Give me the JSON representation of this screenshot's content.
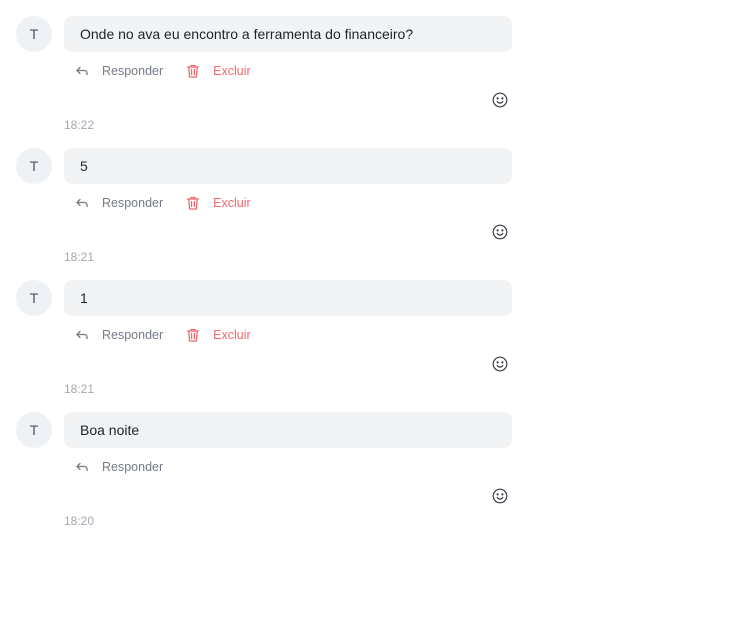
{
  "messages": [
    {
      "avatar_initial": "T",
      "text": "Onde no ava eu encontro a ferramenta do financeiro?",
      "actions": [
        {
          "type": "reply",
          "label": "Responder",
          "icon": "reply-arrow-icon"
        },
        {
          "type": "delete",
          "label": "Excluir",
          "icon": "trash-icon"
        }
      ],
      "reaction_icon": "smiley-icon",
      "time": "18:22"
    },
    {
      "avatar_initial": "T",
      "text": "5",
      "actions": [
        {
          "type": "reply",
          "label": "Responder",
          "icon": "reply-arrow-icon"
        },
        {
          "type": "delete",
          "label": "Excluir",
          "icon": "trash-icon"
        }
      ],
      "reaction_icon": "smiley-icon",
      "time": "18:21"
    },
    {
      "avatar_initial": "T",
      "text": "1",
      "actions": [
        {
          "type": "reply",
          "label": "Responder",
          "icon": "reply-arrow-icon"
        },
        {
          "type": "delete",
          "label": "Excluir",
          "icon": "trash-icon"
        }
      ],
      "reaction_icon": "smiley-icon",
      "time": "18:21"
    },
    {
      "avatar_initial": "T",
      "text": "Boa noite",
      "actions": [
        {
          "type": "reply",
          "label": "Responder",
          "icon": "reply-arrow-icon"
        }
      ],
      "reaction_icon": "smiley-icon",
      "time": "18:20"
    }
  ],
  "colors": {
    "bubble_bg": "#f2f3f5",
    "avatar_bg": "#eef1f5",
    "reply": "#737b86",
    "delete": "#ef6a6a",
    "timestamp": "#a3a9b2"
  }
}
